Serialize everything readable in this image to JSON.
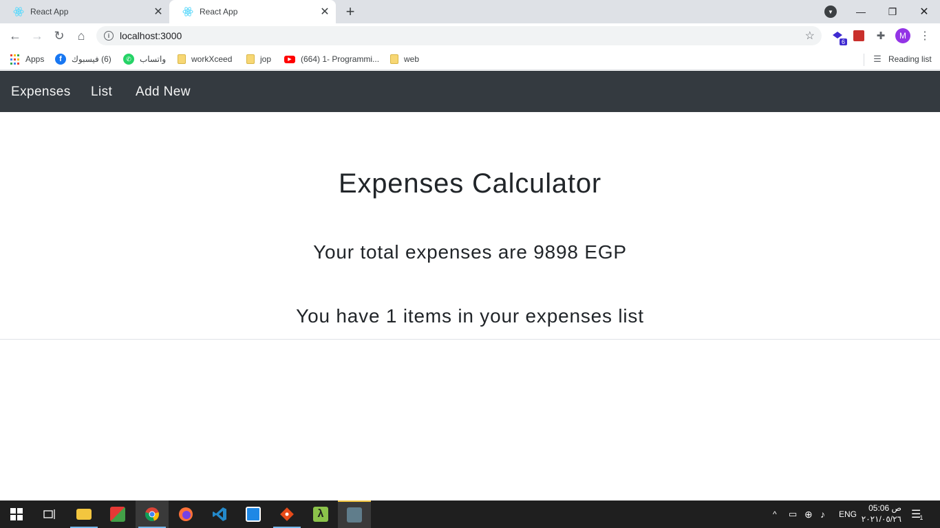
{
  "browser": {
    "tabs": [
      {
        "title": "React App",
        "active": false,
        "icon": "react-icon"
      },
      {
        "title": "React App",
        "active": true,
        "icon": "react-icon"
      }
    ],
    "url": "localhost:3000",
    "extension_badge": "6",
    "profile_initial": "M",
    "bookmarks": [
      {
        "label": "Apps",
        "icon": "apps-grid-icon"
      },
      {
        "label": "(6) فيسبوك",
        "icon": "facebook-icon"
      },
      {
        "label": "واتساب",
        "icon": "whatsapp-icon"
      },
      {
        "label": "workXceed",
        "icon": "folder-icon"
      },
      {
        "label": "jop",
        "icon": "folder-icon"
      },
      {
        "label": "(664) 1- Programmi...",
        "icon": "youtube-icon"
      },
      {
        "label": "web",
        "icon": "folder-icon"
      }
    ],
    "reading_list": "Reading list"
  },
  "navbar": {
    "brand": "Expenses",
    "links": [
      "List",
      "Add New"
    ],
    "bg_color": "#343a40"
  },
  "main": {
    "title": "Expenses Calculator",
    "total_text": "Your total expenses are 9898 EGP",
    "count_text": "You have 1 items in your expenses list"
  },
  "taskbar": {
    "apps": [
      "windows-start-icon",
      "task-view-icon",
      "file-explorer-icon",
      "app-icon",
      "chrome-icon",
      "firefox-icon",
      "vscode-icon",
      "app-icon",
      "git-icon",
      "app-icon",
      "app-icon"
    ],
    "language": "ENG",
    "time": "05:06 ص",
    "date": "٢٠٢١/٠٥/٢٦",
    "notification_count": "1"
  }
}
